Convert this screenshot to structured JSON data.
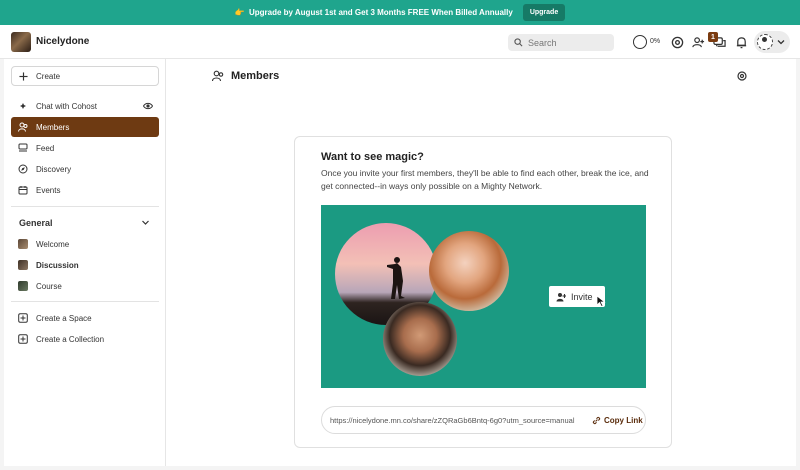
{
  "banner": {
    "emoji": "👉",
    "text": "Upgrade by August 1st and Get 3 Months FREE When Billed Annually",
    "button_label": "Upgrade"
  },
  "header": {
    "brand": "Nicelydone",
    "search_placeholder": "Search",
    "progress_label": "0%",
    "chat_badge": "1",
    "icons": [
      "progress-ring-icon",
      "gear-icon",
      "add-person-icon",
      "chat-icon",
      "bell-icon",
      "avatar",
      "chevron-down-icon"
    ]
  },
  "sidebar": {
    "create_label": "Create",
    "top_items": [
      {
        "label": "Chat with Cohost",
        "icon": "sparkle-icon"
      },
      {
        "label": "Members",
        "icon": "members-icon",
        "active": true
      },
      {
        "label": "Feed",
        "icon": "feed-icon"
      },
      {
        "label": "Discovery",
        "icon": "compass-icon"
      },
      {
        "label": "Events",
        "icon": "calendar-icon"
      }
    ],
    "section_title": "General",
    "spaces": [
      {
        "label": "Welcome",
        "bold": false
      },
      {
        "label": "Discussion",
        "bold": true
      },
      {
        "label": "Course",
        "bold": false
      }
    ],
    "bottom_items": [
      {
        "label": "Create a Space"
      },
      {
        "label": "Create a Collection"
      }
    ]
  },
  "main": {
    "title": "Members",
    "card": {
      "title": "Want to see magic?",
      "text": "Once you invite your first members, they'll be able to find each other, break the ice, and get connected--in ways only possible on a Mighty Network.",
      "invite_label": "Invite",
      "link_url": "https://nicelydone.mn.co/share/zZQRaGb6Bntq-6g0?utm_source=manual",
      "copy_label": "Copy Link"
    }
  }
}
